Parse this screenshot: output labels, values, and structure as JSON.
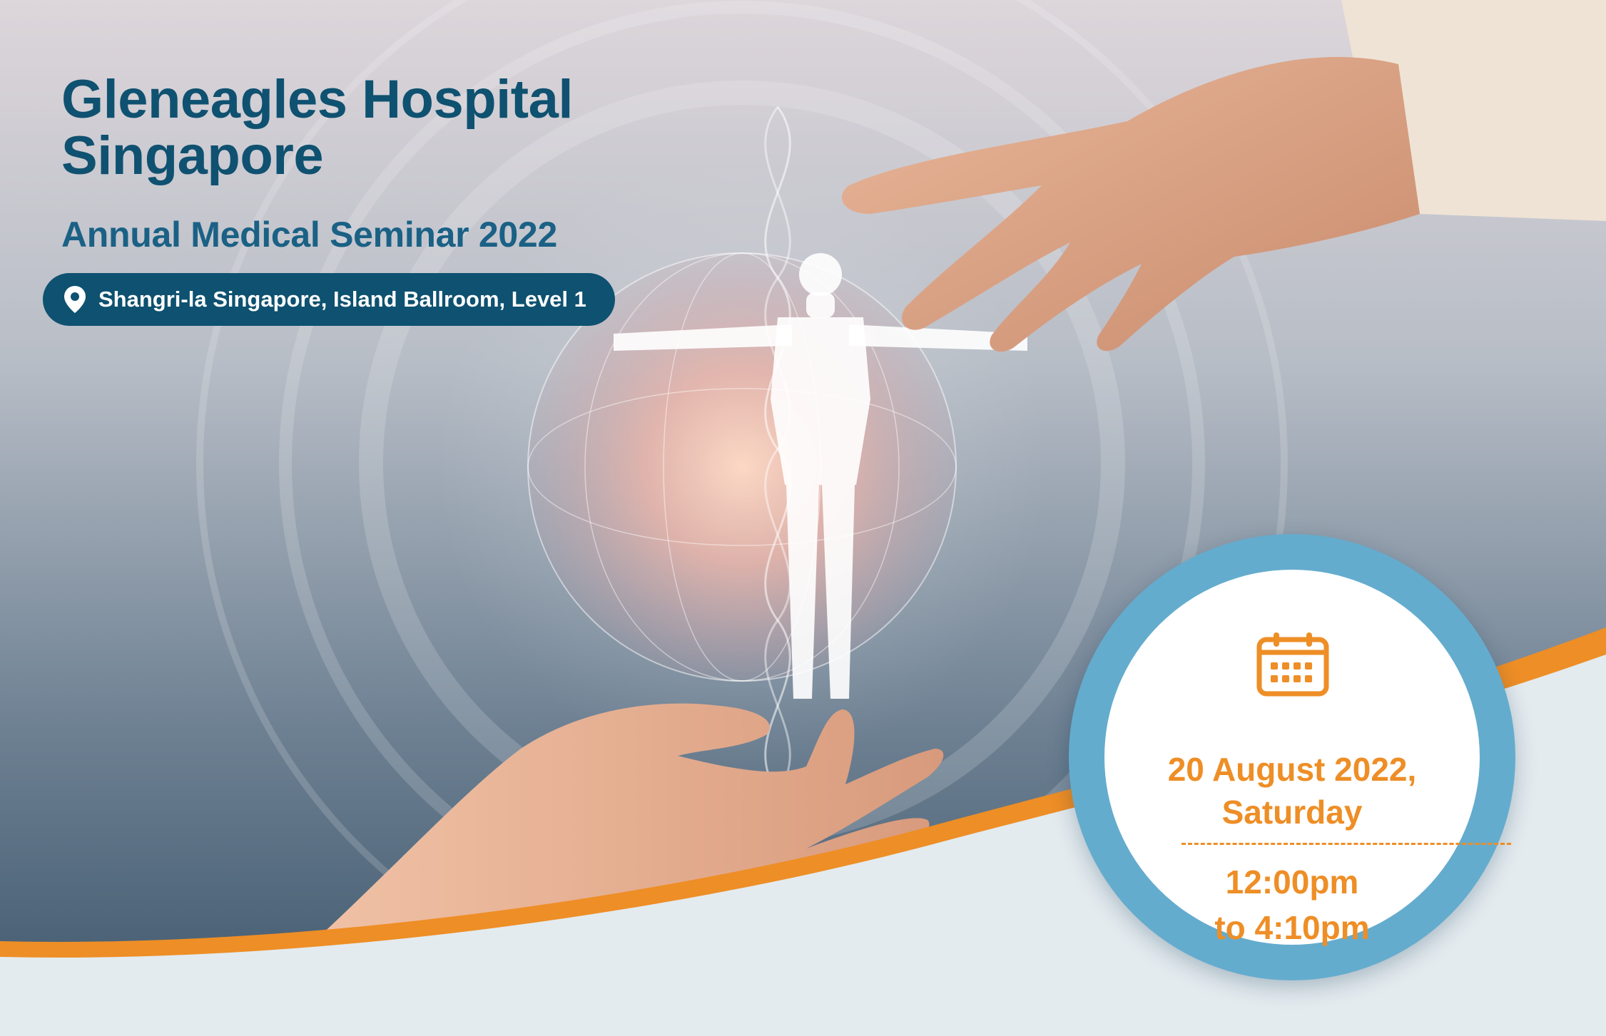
{
  "event": {
    "title_line1": "Gleneagles Hospital",
    "title_line2": "Singapore",
    "subtitle": "Annual Medical Seminar 2022",
    "location": "Shangri-la Singapore, Island Ballroom, Level 1",
    "date": "20 August 2022,",
    "day": "Saturday",
    "time_start": "12:00pm",
    "time_end": "to 4:10pm"
  },
  "icons": {
    "location": "location-pin-icon",
    "date": "calendar-icon"
  },
  "colors": {
    "brand_blue": "#0f5170",
    "accent_orange": "#ee8e26",
    "circle_blue": "#64acce",
    "footer": "#e3ebef"
  }
}
